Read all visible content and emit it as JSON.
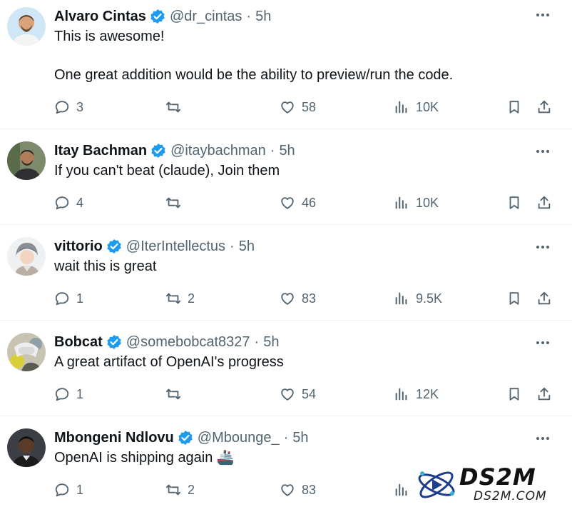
{
  "colors": {
    "text": "#0f1419",
    "muted": "#536471",
    "verified": "#1d9bf0",
    "divider": "#eff3f4"
  },
  "tweets": [
    {
      "name": "Alvaro Cintas",
      "handle": "@dr_cintas",
      "time": "5h",
      "text": "This is awesome!\n\nOne great addition would be the ability to preview/run the code.",
      "replies": "3",
      "retweets": "",
      "likes": "58",
      "views": "10K",
      "avatar_icon": "avatar-man-icon"
    },
    {
      "name": "Itay Bachman",
      "handle": "@itaybachman",
      "time": "5h",
      "text": "If you can't beat (claude), Join them",
      "replies": "4",
      "retweets": "",
      "likes": "46",
      "views": "10K",
      "avatar_icon": "avatar-man-icon"
    },
    {
      "name": "vittorio",
      "handle": "@IterIntellectus",
      "time": "5h",
      "text": "wait this is great",
      "replies": "1",
      "retweets": "2",
      "likes": "83",
      "views": "9.5K",
      "avatar_icon": "avatar-anime-icon"
    },
    {
      "name": "Bobcat",
      "handle": "@somebobcat8327",
      "time": "5h",
      "text": "A great artifact of OpenAI's progress",
      "replies": "1",
      "retweets": "",
      "likes": "54",
      "views": "12K",
      "avatar_icon": "avatar-figure-icon"
    },
    {
      "name": "Mbongeni Ndlovu",
      "handle": "@Mbounge_",
      "time": "5h",
      "text": "OpenAI is shipping again 🚢",
      "replies": "1",
      "retweets": "2",
      "likes": "83",
      "views": "",
      "avatar_icon": "avatar-man-icon"
    }
  ],
  "separator": "·",
  "watermark": {
    "brand": "DS2M",
    "domain": "DS2M.COM"
  }
}
